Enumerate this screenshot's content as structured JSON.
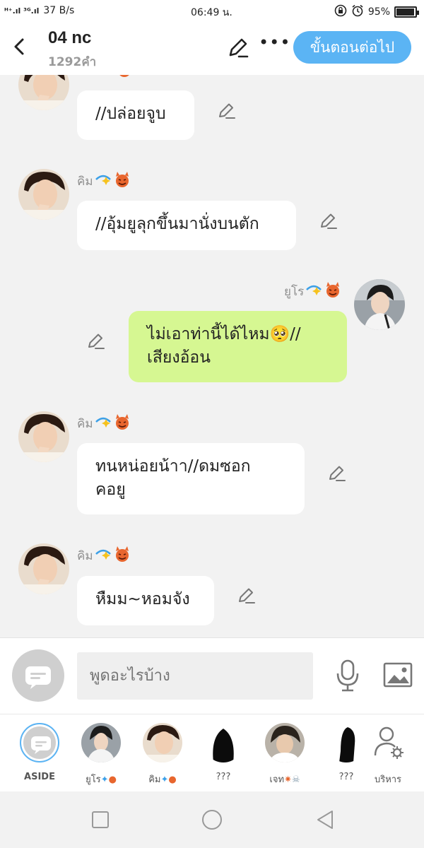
{
  "status_bar": {
    "signal": "ᴴ⁺.ıl ³ᴳ.ıl",
    "speed": "37 B/s",
    "time": "06:49 น.",
    "battery_text": "95%",
    "battery_level": 0.95
  },
  "header": {
    "title": "04 nc",
    "word_count": "1292คำ",
    "next_label": "ขั้นตอนต่อไป",
    "more_glyph": "•••"
  },
  "messages": [
    {
      "speaker": "",
      "text": "//ปล่อยจูบ",
      "side": "left"
    },
    {
      "speaker": "คิม",
      "text": "//อุ้มยูลุกขึ้นมานั่งบนตัก",
      "side": "left"
    },
    {
      "speaker": "ยูโร",
      "text_lines": [
        "ไม่เอาท่านี้ได้ไหม🥺//",
        "เสียงอ้อน"
      ],
      "side": "right"
    },
    {
      "speaker": "คิม",
      "text_lines": [
        "ทนหน่อยน้าา//ดมซอก",
        "คอยู"
      ],
      "side": "left"
    },
    {
      "speaker": "คิม",
      "text": "หืมม~หอมจัง",
      "side": "left"
    }
  ],
  "input": {
    "placeholder": "พูดอะไรบ้าง"
  },
  "characters": [
    {
      "label": "ASIDE"
    },
    {
      "label": "ยูโร"
    },
    {
      "label": "คิม"
    },
    {
      "label": "???"
    },
    {
      "label": "เจท"
    },
    {
      "label": "???"
    },
    {
      "label": "บริหาร"
    }
  ],
  "colors": {
    "accent": "#5bb4f4",
    "my_bubble": "#d6f792",
    "other_bubble": "#ffffff",
    "background": "#f2f2f2"
  },
  "icons": [
    "back-icon",
    "edit-icon",
    "more-icon",
    "pencil-icon",
    "chat-bubble-icon",
    "microphone-icon",
    "image-icon",
    "manage-icon"
  ]
}
